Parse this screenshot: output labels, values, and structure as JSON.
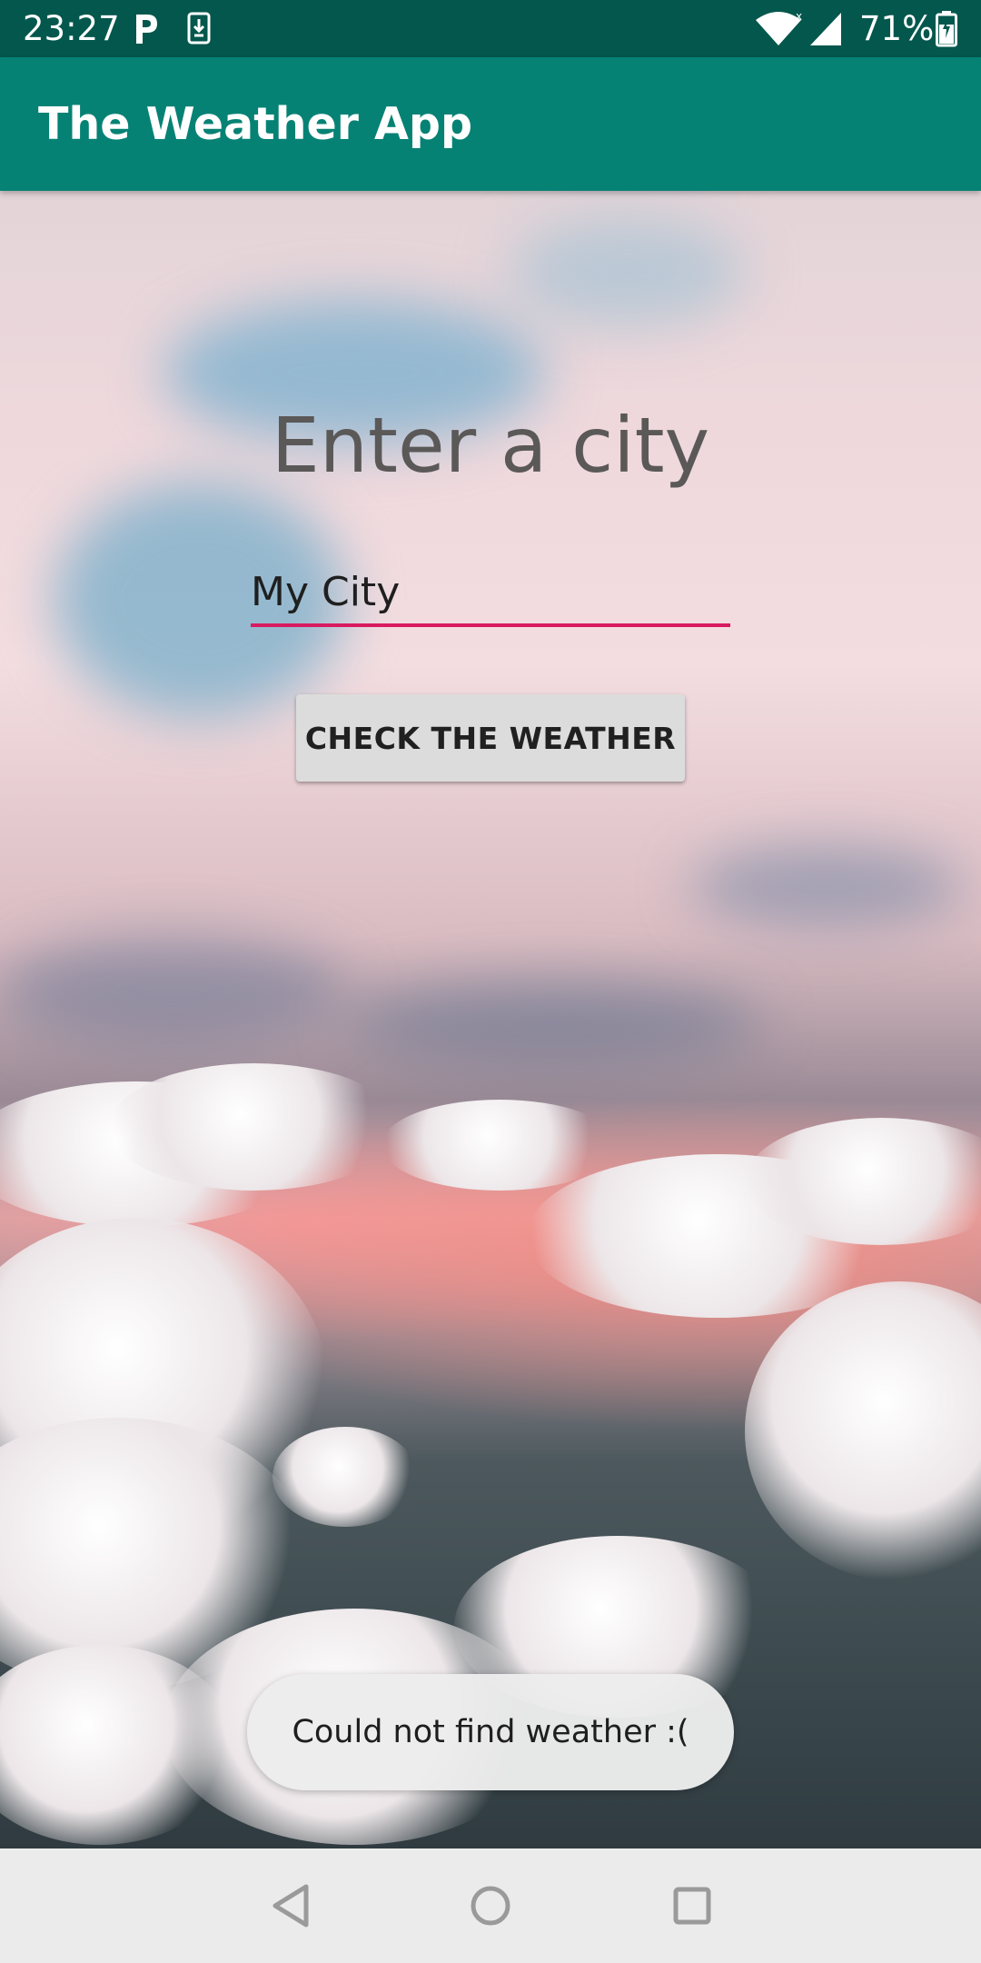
{
  "status_bar": {
    "time": "23:27",
    "battery_percent": "71%",
    "icons": [
      "parking-icon",
      "download-icon",
      "wifi-icon",
      "signal-icon",
      "battery-icon"
    ]
  },
  "app_bar": {
    "title": "The Weather App",
    "color": "#068275"
  },
  "form": {
    "heading": "Enter a city",
    "city_input": {
      "value": "My City",
      "underline_color": "#d81b60"
    },
    "check_button_label": "CHECK THE WEATHER"
  },
  "toast": {
    "message": "Could not find weather :("
  },
  "nav_bar": {
    "buttons": [
      "back-icon",
      "home-icon",
      "recents-icon"
    ]
  }
}
